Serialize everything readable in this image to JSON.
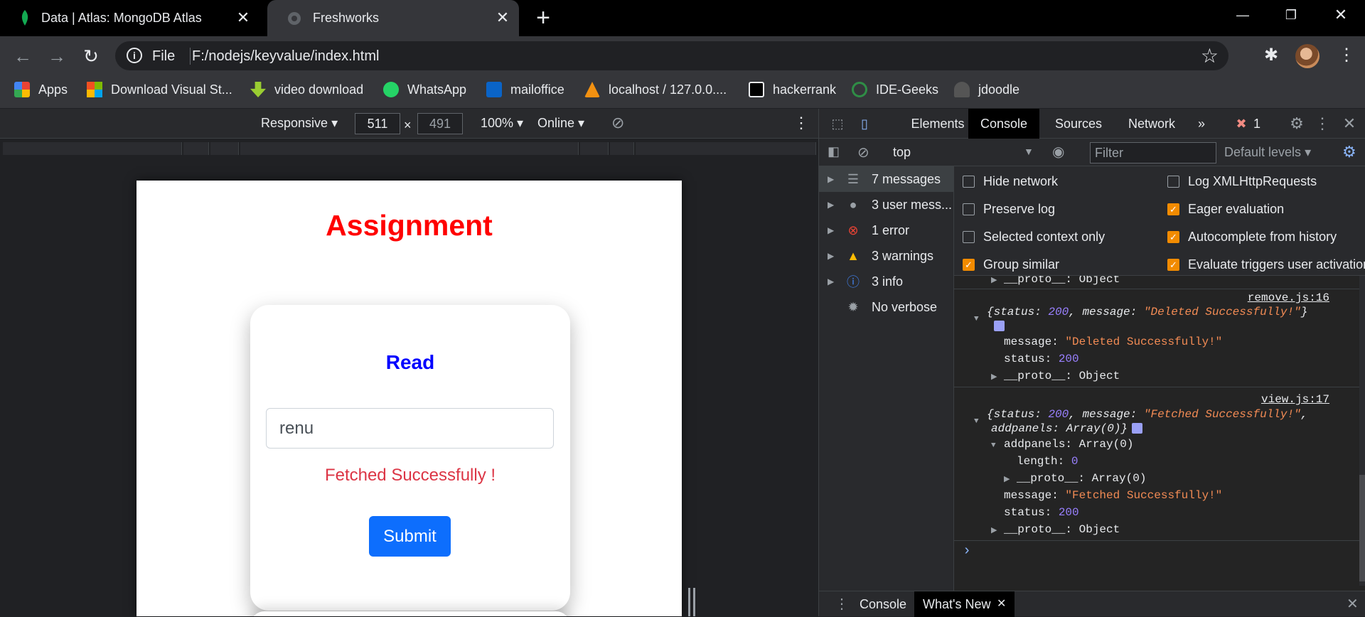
{
  "browser": {
    "tabs": [
      {
        "title": "Data | Atlas: MongoDB Atlas"
      },
      {
        "title": "Freshworks"
      }
    ],
    "address": {
      "scheme": "File",
      "url": "F:/nodejs/keyvalue/index.html"
    },
    "bookmarks": [
      {
        "label": "Apps",
        "icon": "apps-grid-icon"
      },
      {
        "label": "Download Visual St...",
        "icon": "windows-icon"
      },
      {
        "label": "video download",
        "icon": "download-arrow-icon"
      },
      {
        "label": "WhatsApp",
        "icon": "whatsapp-icon"
      },
      {
        "label": "mailoffice",
        "icon": "outlook-icon"
      },
      {
        "label": "localhost / 127.0.0....",
        "icon": "phpmyadmin-icon"
      },
      {
        "label": "hackerrank",
        "icon": "hackerrank-icon"
      },
      {
        "label": "IDE-Geeks",
        "icon": "geeksforgeeks-icon"
      },
      {
        "label": "jdoodle",
        "icon": "jdoodle-icon"
      }
    ]
  },
  "device_toolbar": {
    "mode": "Responsive",
    "width": "511",
    "times": "×",
    "height": "491",
    "zoom": "100%",
    "network": "Online"
  },
  "page": {
    "title": "Assignment",
    "card_title": "Read",
    "input_value": "renu",
    "message": "Fetched Successfully !",
    "submit_label": "Submit"
  },
  "devtools": {
    "tabs": [
      "Elements",
      "Console",
      "Sources",
      "Network",
      "»"
    ],
    "error_count": "1",
    "context": "top",
    "filter_placeholder": "Filter",
    "levels": "Default levels",
    "sidebar": [
      {
        "label": "7 messages",
        "icon": "list-icon"
      },
      {
        "label": "3 user mess...",
        "icon": "user-icon"
      },
      {
        "label": "1 error",
        "icon": "error-icon"
      },
      {
        "label": "3 warnings",
        "icon": "warning-icon"
      },
      {
        "label": "3 info",
        "icon": "info-icon"
      },
      {
        "label": "No verbose",
        "icon": "bug-icon"
      }
    ],
    "settings": [
      {
        "label": "Hide network",
        "checked": false
      },
      {
        "label": "Log XMLHttpRequests",
        "checked": false
      },
      {
        "label": "Preserve log",
        "checked": false
      },
      {
        "label": "Eager evaluation",
        "checked": true
      },
      {
        "label": "Selected context only",
        "checked": false
      },
      {
        "label": "Autocomplete from history",
        "checked": true
      },
      {
        "label": "Group similar",
        "checked": true
      },
      {
        "label": "Evaluate triggers user activation",
        "checked": true
      }
    ],
    "console": {
      "proto_object": "__proto__: Object",
      "log1_source": "remove.js:16",
      "log1_summary_a": "{status: ",
      "log1_status": "200",
      "log1_summary_b": ", message: ",
      "log1_message": "\"Deleted Successfully!\"",
      "log1_summary_c": "}",
      "log1_msg_key": "message: ",
      "log1_msg_val": "\"Deleted Successfully!\"",
      "log1_status_key": "status: ",
      "log1_status_val": "200",
      "log2_source": "view.js:17",
      "log2_summary_a": "{status: ",
      "log2_status": "200",
      "log2_summary_b": ", message: ",
      "log2_message": "\"Fetched Successfully!\"",
      "log2_summary_c": ",",
      "log2_summary_d": "addpanels: Array(0)}",
      "log2_addpanels": "addpanels: Array(0)",
      "log2_length_key": "length: ",
      "log2_length_val": "0",
      "log2_proto_array": "__proto__: Array(0)",
      "log2_msg_key": "message: ",
      "log2_msg_val": "\"Fetched Successfully!\"",
      "log2_status_key": "status: ",
      "log2_status_val": "200",
      "prompt": "›"
    },
    "drawer_tabs": [
      "Console",
      "What's New"
    ]
  }
}
